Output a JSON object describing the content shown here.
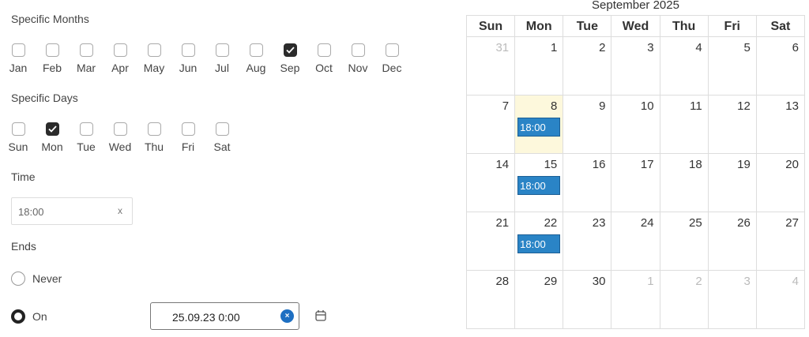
{
  "months": {
    "label": "Specific Months",
    "items": [
      {
        "label": "Jan",
        "checked": false
      },
      {
        "label": "Feb",
        "checked": false
      },
      {
        "label": "Mar",
        "checked": false
      },
      {
        "label": "Apr",
        "checked": false
      },
      {
        "label": "May",
        "checked": false
      },
      {
        "label": "Jun",
        "checked": false
      },
      {
        "label": "Jul",
        "checked": false
      },
      {
        "label": "Aug",
        "checked": false
      },
      {
        "label": "Sep",
        "checked": true
      },
      {
        "label": "Oct",
        "checked": false
      },
      {
        "label": "Nov",
        "checked": false
      },
      {
        "label": "Dec",
        "checked": false
      }
    ]
  },
  "days": {
    "label": "Specific Days",
    "items": [
      {
        "label": "Sun",
        "checked": false
      },
      {
        "label": "Mon",
        "checked": true
      },
      {
        "label": "Tue",
        "checked": false
      },
      {
        "label": "Wed",
        "checked": false
      },
      {
        "label": "Thu",
        "checked": false
      },
      {
        "label": "Fri",
        "checked": false
      },
      {
        "label": "Sat",
        "checked": false
      }
    ]
  },
  "time": {
    "label": "Time",
    "value": "18:00",
    "clear": "x"
  },
  "ends": {
    "label": "Ends",
    "never_label": "Never",
    "on_label": "On",
    "selected": "on",
    "date_value": "25.09.23 0:00",
    "clear": "×"
  },
  "calendar": {
    "title": "September 2025",
    "weekdays": [
      "Sun",
      "Mon",
      "Tue",
      "Wed",
      "Thu",
      "Fri",
      "Sat"
    ],
    "weeks": [
      [
        {
          "n": "31",
          "other": true
        },
        {
          "n": "1"
        },
        {
          "n": "2"
        },
        {
          "n": "3"
        },
        {
          "n": "4"
        },
        {
          "n": "5"
        },
        {
          "n": "6"
        }
      ],
      [
        {
          "n": "7"
        },
        {
          "n": "8",
          "today": true,
          "event": "18:00"
        },
        {
          "n": "9"
        },
        {
          "n": "10"
        },
        {
          "n": "11"
        },
        {
          "n": "12"
        },
        {
          "n": "13"
        }
      ],
      [
        {
          "n": "14"
        },
        {
          "n": "15",
          "event": "18:00"
        },
        {
          "n": "16"
        },
        {
          "n": "17"
        },
        {
          "n": "18"
        },
        {
          "n": "19"
        },
        {
          "n": "20"
        }
      ],
      [
        {
          "n": "21"
        },
        {
          "n": "22",
          "event": "18:00"
        },
        {
          "n": "23"
        },
        {
          "n": "24"
        },
        {
          "n": "25"
        },
        {
          "n": "26"
        },
        {
          "n": "27"
        }
      ],
      [
        {
          "n": "28"
        },
        {
          "n": "29"
        },
        {
          "n": "30"
        },
        {
          "n": "1",
          "other": true
        },
        {
          "n": "2",
          "other": true
        },
        {
          "n": "3",
          "other": true
        },
        {
          "n": "4",
          "other": true
        }
      ]
    ]
  }
}
